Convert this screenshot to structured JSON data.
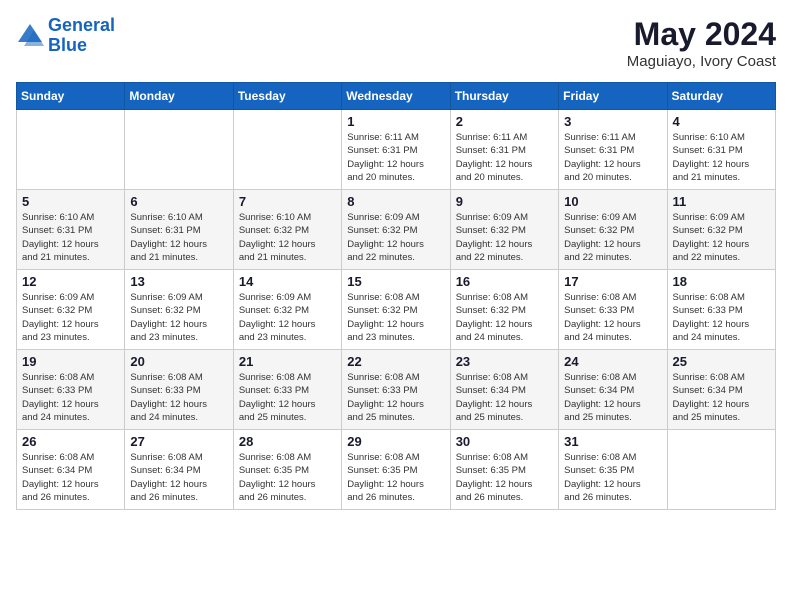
{
  "logo": {
    "line1": "General",
    "line2": "Blue"
  },
  "title": "May 2024",
  "location": "Maguiayo, Ivory Coast",
  "days_of_week": [
    "Sunday",
    "Monday",
    "Tuesday",
    "Wednesday",
    "Thursday",
    "Friday",
    "Saturday"
  ],
  "weeks": [
    [
      {
        "day": "",
        "info": ""
      },
      {
        "day": "",
        "info": ""
      },
      {
        "day": "",
        "info": ""
      },
      {
        "day": "1",
        "info": "Sunrise: 6:11 AM\nSunset: 6:31 PM\nDaylight: 12 hours\nand 20 minutes."
      },
      {
        "day": "2",
        "info": "Sunrise: 6:11 AM\nSunset: 6:31 PM\nDaylight: 12 hours\nand 20 minutes."
      },
      {
        "day": "3",
        "info": "Sunrise: 6:11 AM\nSunset: 6:31 PM\nDaylight: 12 hours\nand 20 minutes."
      },
      {
        "day": "4",
        "info": "Sunrise: 6:10 AM\nSunset: 6:31 PM\nDaylight: 12 hours\nand 21 minutes."
      }
    ],
    [
      {
        "day": "5",
        "info": "Sunrise: 6:10 AM\nSunset: 6:31 PM\nDaylight: 12 hours\nand 21 minutes."
      },
      {
        "day": "6",
        "info": "Sunrise: 6:10 AM\nSunset: 6:31 PM\nDaylight: 12 hours\nand 21 minutes."
      },
      {
        "day": "7",
        "info": "Sunrise: 6:10 AM\nSunset: 6:32 PM\nDaylight: 12 hours\nand 21 minutes."
      },
      {
        "day": "8",
        "info": "Sunrise: 6:09 AM\nSunset: 6:32 PM\nDaylight: 12 hours\nand 22 minutes."
      },
      {
        "day": "9",
        "info": "Sunrise: 6:09 AM\nSunset: 6:32 PM\nDaylight: 12 hours\nand 22 minutes."
      },
      {
        "day": "10",
        "info": "Sunrise: 6:09 AM\nSunset: 6:32 PM\nDaylight: 12 hours\nand 22 minutes."
      },
      {
        "day": "11",
        "info": "Sunrise: 6:09 AM\nSunset: 6:32 PM\nDaylight: 12 hours\nand 22 minutes."
      }
    ],
    [
      {
        "day": "12",
        "info": "Sunrise: 6:09 AM\nSunset: 6:32 PM\nDaylight: 12 hours\nand 23 minutes."
      },
      {
        "day": "13",
        "info": "Sunrise: 6:09 AM\nSunset: 6:32 PM\nDaylight: 12 hours\nand 23 minutes."
      },
      {
        "day": "14",
        "info": "Sunrise: 6:09 AM\nSunset: 6:32 PM\nDaylight: 12 hours\nand 23 minutes."
      },
      {
        "day": "15",
        "info": "Sunrise: 6:08 AM\nSunset: 6:32 PM\nDaylight: 12 hours\nand 23 minutes."
      },
      {
        "day": "16",
        "info": "Sunrise: 6:08 AM\nSunset: 6:32 PM\nDaylight: 12 hours\nand 24 minutes."
      },
      {
        "day": "17",
        "info": "Sunrise: 6:08 AM\nSunset: 6:33 PM\nDaylight: 12 hours\nand 24 minutes."
      },
      {
        "day": "18",
        "info": "Sunrise: 6:08 AM\nSunset: 6:33 PM\nDaylight: 12 hours\nand 24 minutes."
      }
    ],
    [
      {
        "day": "19",
        "info": "Sunrise: 6:08 AM\nSunset: 6:33 PM\nDaylight: 12 hours\nand 24 minutes."
      },
      {
        "day": "20",
        "info": "Sunrise: 6:08 AM\nSunset: 6:33 PM\nDaylight: 12 hours\nand 24 minutes."
      },
      {
        "day": "21",
        "info": "Sunrise: 6:08 AM\nSunset: 6:33 PM\nDaylight: 12 hours\nand 25 minutes."
      },
      {
        "day": "22",
        "info": "Sunrise: 6:08 AM\nSunset: 6:33 PM\nDaylight: 12 hours\nand 25 minutes."
      },
      {
        "day": "23",
        "info": "Sunrise: 6:08 AM\nSunset: 6:34 PM\nDaylight: 12 hours\nand 25 minutes."
      },
      {
        "day": "24",
        "info": "Sunrise: 6:08 AM\nSunset: 6:34 PM\nDaylight: 12 hours\nand 25 minutes."
      },
      {
        "day": "25",
        "info": "Sunrise: 6:08 AM\nSunset: 6:34 PM\nDaylight: 12 hours\nand 25 minutes."
      }
    ],
    [
      {
        "day": "26",
        "info": "Sunrise: 6:08 AM\nSunset: 6:34 PM\nDaylight: 12 hours\nand 26 minutes."
      },
      {
        "day": "27",
        "info": "Sunrise: 6:08 AM\nSunset: 6:34 PM\nDaylight: 12 hours\nand 26 minutes."
      },
      {
        "day": "28",
        "info": "Sunrise: 6:08 AM\nSunset: 6:35 PM\nDaylight: 12 hours\nand 26 minutes."
      },
      {
        "day": "29",
        "info": "Sunrise: 6:08 AM\nSunset: 6:35 PM\nDaylight: 12 hours\nand 26 minutes."
      },
      {
        "day": "30",
        "info": "Sunrise: 6:08 AM\nSunset: 6:35 PM\nDaylight: 12 hours\nand 26 minutes."
      },
      {
        "day": "31",
        "info": "Sunrise: 6:08 AM\nSunset: 6:35 PM\nDaylight: 12 hours\nand 26 minutes."
      },
      {
        "day": "",
        "info": ""
      }
    ]
  ]
}
